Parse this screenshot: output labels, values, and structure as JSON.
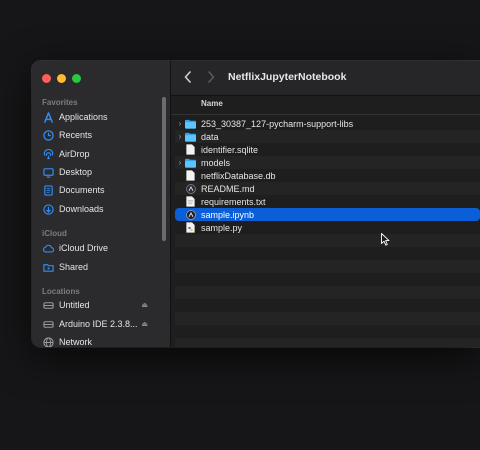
{
  "window": {
    "title": "NetflixJupyterNotebook"
  },
  "sidebar": {
    "favorites_title": "Favorites",
    "favorites": [
      {
        "label": "Applications",
        "icon": "applications-icon"
      },
      {
        "label": "Recents",
        "icon": "clock-icon"
      },
      {
        "label": "AirDrop",
        "icon": "airdrop-icon"
      },
      {
        "label": "Desktop",
        "icon": "desktop-icon"
      },
      {
        "label": "Documents",
        "icon": "document-icon"
      },
      {
        "label": "Downloads",
        "icon": "download-icon"
      }
    ],
    "icloud_title": "iCloud",
    "icloud": [
      {
        "label": "iCloud Drive",
        "icon": "cloud-icon"
      },
      {
        "label": "Shared",
        "icon": "shared-folder-icon"
      }
    ],
    "locations_title": "Locations",
    "locations": [
      {
        "label": "Untitled",
        "icon": "disk-icon"
      },
      {
        "label": "Arduino IDE 2.3.8...",
        "icon": "disk-icon"
      },
      {
        "label": "Network",
        "icon": "globe-icon"
      }
    ]
  },
  "list": {
    "column_name": "Name",
    "files": [
      {
        "name": "253_30387_127-pycharm-support-libs",
        "kind": "folder",
        "expandable": true
      },
      {
        "name": "data",
        "kind": "folder",
        "expandable": true
      },
      {
        "name": "identifier.sqlite",
        "kind": "file",
        "expandable": false
      },
      {
        "name": "models",
        "kind": "folder",
        "expandable": true
      },
      {
        "name": "netflixDatabase.db",
        "kind": "file",
        "expandable": false
      },
      {
        "name": "README.md",
        "kind": "markdown",
        "expandable": false
      },
      {
        "name": "requirements.txt",
        "kind": "file",
        "expandable": false
      },
      {
        "name": "sample.ipynb",
        "kind": "notebook",
        "expandable": false,
        "selected": true
      },
      {
        "name": "sample.py",
        "kind": "python",
        "expandable": false
      }
    ]
  },
  "colors": {
    "accent": "#0a5ed7",
    "folder": "#2ca6f2",
    "sidebar_icon": "#2f8cf5"
  }
}
